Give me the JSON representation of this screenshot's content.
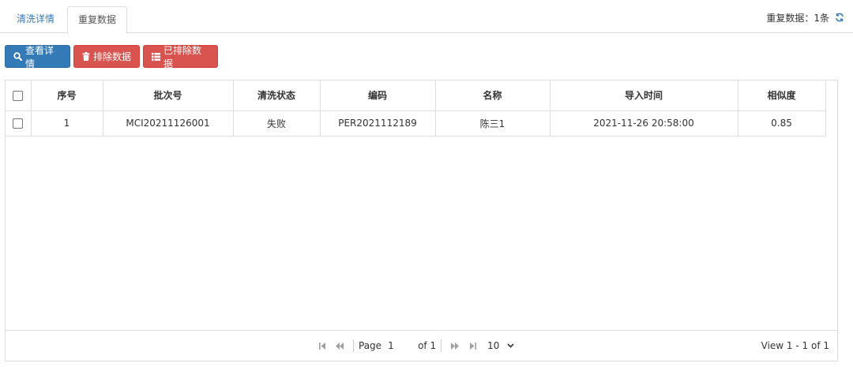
{
  "tabs": [
    {
      "label": "清洗详情"
    },
    {
      "label": "重复数据"
    }
  ],
  "duplicate_summary": "重复数据：1条",
  "toolbar": {
    "view_details": "查看详情",
    "exclude_data": "排除数据",
    "excluded_data": "已排除数据"
  },
  "table": {
    "headers": [
      "序号",
      "批次号",
      "清洗状态",
      "编码",
      "名称",
      "导入时间",
      "相似度"
    ],
    "rows": [
      [
        "1",
        "MCI20211126001",
        "失败",
        "PER2021112189",
        "陈三1",
        "2021-11-26 20:58:00",
        "0.85"
      ]
    ]
  },
  "pager": {
    "page_label": "Page",
    "page_value": "1",
    "of_label": "of 1",
    "page_size": "10",
    "view_info": "View 1 - 1 of 1"
  },
  "colors": {
    "primary": "#337ab7",
    "danger": "#d9534f",
    "border": "#dddddd"
  }
}
